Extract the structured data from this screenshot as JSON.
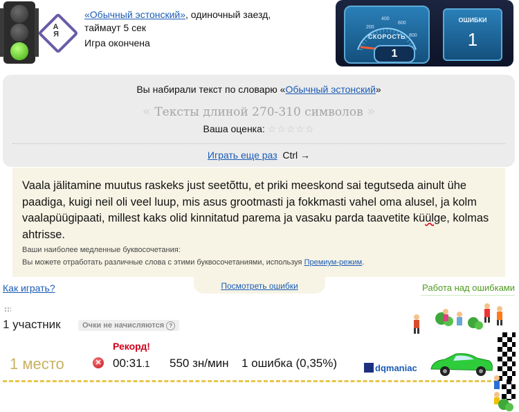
{
  "header": {
    "dict_link": "«Обычный эстонский»",
    "mode_suffix": ", одиночный заезд,",
    "timeout": "таймаут 5 сек",
    "status": "Игра окончена"
  },
  "dashboard": {
    "speed_label": "СКОРОСТЬ",
    "speed_value": "1",
    "dial_numbers": [
      "200",
      "400",
      "600",
      "800"
    ],
    "errors_label": "ОШИБКИ",
    "errors_value": "1"
  },
  "result_panel": {
    "typed_from_prefix": "Вы набирали текст по словарю «",
    "dict_name": "Обычный эстонский",
    "typed_from_suffix": "»",
    "text_length": "Тексты длиной 270-310 символов",
    "rating_label": "Ваша оценка:",
    "play_again": "Играть еще раз",
    "shortcut": "Ctrl →"
  },
  "typed_text": {
    "before": "Vaala jälitamine muutus raskeks just seetõttu, et priki meeskond sai tegutseda ainult ühe paadiga, kuigi neil oli veel luup, mis asus grootmasti ja fokkmasti vahel oma alusel, ja kolm vaalapüügipaati, millest kaks olid kinnitatud parema ja vasaku parda taavetite kü",
    "error": "ül",
    "after": "ge, kolmas ahtrisse.",
    "slow_title": "Ваши наиболее медленные буквосочетания:",
    "slow_hint": "Вы можете отработать различные слова с этими буквосочетаниями, используя ",
    "premium_link": "Премиум-режим",
    "slow_hint_end": "."
  },
  "links": {
    "show_errors": "Посмотреть ошибки",
    "how_to_play": "Как играть?",
    "work_on_errors": "Работа над ошибками"
  },
  "participants": {
    "count_label": "1 участник",
    "not_counted": "Очки не начисляются",
    "record": "Рекорд!",
    "place": "1 место",
    "time_main": "00:31",
    "time_frac": ".1",
    "speed": "550 зн/мин",
    "errors": "1 ошибка (0,35%)",
    "username": "dqmaniac"
  },
  "colors": {
    "link": "#1a5bb5",
    "record": "#d0001c",
    "place": "#c9b060",
    "work_errors": "#4f9a1f",
    "car": "#2ecc3a"
  }
}
